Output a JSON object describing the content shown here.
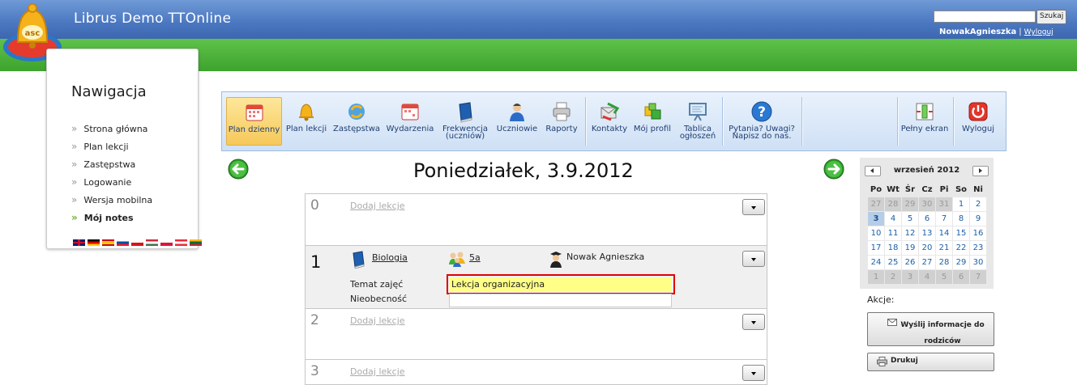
{
  "header": {
    "title": "Librus Demo TTOnline",
    "search_placeholder": "",
    "search_button": "Szukaj",
    "user_name": "NowakAgnieszka",
    "separator": "|",
    "logout_link": "Wyloguj"
  },
  "nav": {
    "title": "Nawigacja",
    "items": [
      {
        "label": "Strona główna"
      },
      {
        "label": "Plan lekcji"
      },
      {
        "label": "Zastępstwa"
      },
      {
        "label": "Logowanie"
      },
      {
        "label": "Wersja mobilna"
      },
      {
        "label": "Mój notes",
        "active": true
      }
    ],
    "flags": [
      "gb",
      "de",
      "es",
      "sk",
      "cz",
      "hu",
      "pl",
      "at",
      "lt"
    ]
  },
  "toolbar": {
    "items": [
      {
        "label": "Plan dzienny",
        "icon": "calendar-icon",
        "active": true
      },
      {
        "label": "Plan lekcji",
        "icon": "bell-icon"
      },
      {
        "label": "Zastępstwa",
        "icon": "swap-icon"
      },
      {
        "label": "Wydarzenia",
        "icon": "events-icon"
      },
      {
        "label": "Frekwencja (uczniów)",
        "icon": "book-icon"
      },
      {
        "label": "Uczniowie",
        "icon": "student-icon"
      },
      {
        "label": "Raporty",
        "icon": "printer-icon"
      },
      {
        "label": "Kontakty",
        "icon": "contacts-icon"
      },
      {
        "label": "Mój profil",
        "icon": "profile-icon"
      },
      {
        "label": "Tablica ogłoszeń",
        "icon": "board-icon"
      },
      {
        "label": "Pytania? Uwagi? Napisz do nas.",
        "icon": "help-icon"
      },
      {
        "label": "Pełny ekran",
        "icon": "fullscreen-icon"
      },
      {
        "label": "Wyloguj",
        "icon": "power-icon"
      }
    ]
  },
  "day": {
    "title": "Poniedziałek, 3.9.2012"
  },
  "lessons": [
    {
      "number": "0",
      "add_label": "Dodaj lekcje"
    },
    {
      "number": "1",
      "subject": "Biologia",
      "class": "5a",
      "teacher": "Nowak Agnieszka",
      "topic_label": "Temat zajęć",
      "topic_value": "Lekcja organizacyjna",
      "absence_label": "Nieobecność"
    },
    {
      "number": "2",
      "add_label": "Dodaj lekcje"
    },
    {
      "number": "3",
      "add_label": "Dodaj lekcje"
    }
  ],
  "calendar": {
    "month": "wrzesień 2012",
    "weekdays": [
      "Po",
      "Wt",
      "Śr",
      "Cz",
      "Pi",
      "So",
      "Ni"
    ],
    "weeks": [
      [
        [
          "27",
          0
        ],
        [
          "28",
          0
        ],
        [
          "29",
          0
        ],
        [
          "30",
          0
        ],
        [
          "31",
          0
        ],
        [
          "1",
          1
        ],
        [
          "2",
          1
        ]
      ],
      [
        [
          "3",
          2
        ],
        [
          "4",
          1
        ],
        [
          "5",
          1
        ],
        [
          "6",
          1
        ],
        [
          "7",
          1
        ],
        [
          "8",
          1
        ],
        [
          "9",
          1
        ]
      ],
      [
        [
          "10",
          1
        ],
        [
          "11",
          1
        ],
        [
          "12",
          1
        ],
        [
          "13",
          1
        ],
        [
          "14",
          1
        ],
        [
          "15",
          1
        ],
        [
          "16",
          1
        ]
      ],
      [
        [
          "17",
          1
        ],
        [
          "18",
          1
        ],
        [
          "19",
          1
        ],
        [
          "20",
          1
        ],
        [
          "21",
          1
        ],
        [
          "22",
          1
        ],
        [
          "23",
          1
        ]
      ],
      [
        [
          "24",
          1
        ],
        [
          "25",
          1
        ],
        [
          "26",
          1
        ],
        [
          "27",
          1
        ],
        [
          "28",
          1
        ],
        [
          "29",
          1
        ],
        [
          "30",
          1
        ]
      ],
      [
        [
          "1",
          0
        ],
        [
          "2",
          0
        ],
        [
          "3",
          0
        ],
        [
          "4",
          0
        ],
        [
          "5",
          0
        ],
        [
          "6",
          0
        ],
        [
          "7",
          0
        ]
      ]
    ]
  },
  "actions": {
    "label": "Akcje:",
    "send_line1": "Wyślij informacje do",
    "send_line2": "rodziców",
    "print": "Drukuj"
  },
  "colors": {
    "header_blue": "#4a77c0",
    "header_green": "#3da32d",
    "highlight_red": "#e00000",
    "highlight_yellow": "#ffff88"
  }
}
